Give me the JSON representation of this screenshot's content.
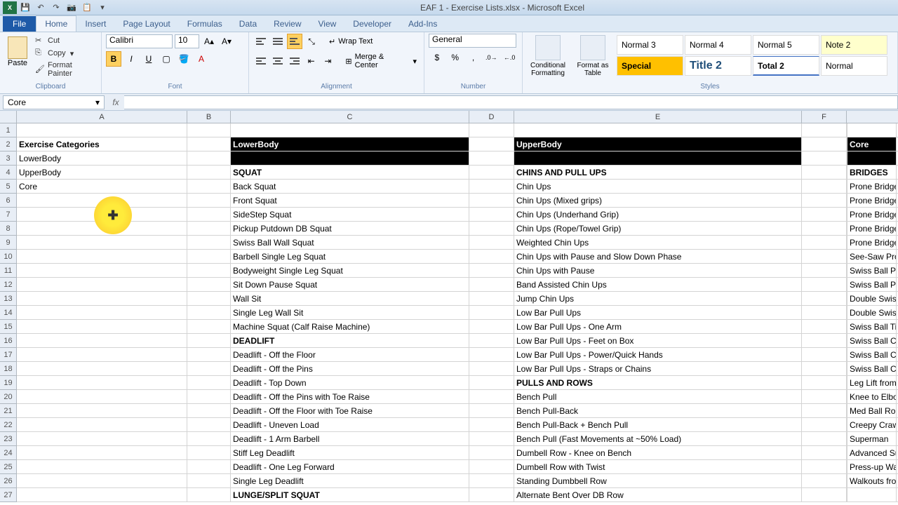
{
  "title": "EAF 1 - Exercise Lists.xlsx - Microsoft Excel",
  "tabs": {
    "file": "File",
    "home": "Home",
    "insert": "Insert",
    "pagelayout": "Page Layout",
    "formulas": "Formulas",
    "data": "Data",
    "review": "Review",
    "view": "View",
    "developer": "Developer",
    "addins": "Add-Ins"
  },
  "ribbon": {
    "clipboard": {
      "paste": "Paste",
      "cut": "Cut",
      "copy": "Copy",
      "format": "Format Painter",
      "label": "Clipboard"
    },
    "font": {
      "name": "Calibri",
      "size": "10",
      "label": "Font"
    },
    "alignment": {
      "wrap": "Wrap Text",
      "merge": "Merge & Center",
      "label": "Alignment"
    },
    "number": {
      "format": "General",
      "label": "Number"
    },
    "styles": {
      "conditional": "Conditional Formatting",
      "astable": "Format as Table",
      "normal3": "Normal 3",
      "normal4": "Normal 4",
      "normal5": "Normal 5",
      "note2": "Note 2",
      "special": "Special",
      "title2": "Title 2",
      "total2": "Total 2",
      "normal": "Normal",
      "label": "Styles"
    }
  },
  "namebox": "Core",
  "columns": [
    "A",
    "B",
    "C",
    "D",
    "E",
    "F"
  ],
  "rownums": [
    1,
    2,
    3,
    4,
    5,
    6,
    7,
    8,
    9,
    10,
    11,
    12,
    13,
    14,
    15,
    16,
    17,
    18,
    19,
    20,
    21,
    22,
    23,
    24,
    25,
    26,
    27
  ],
  "colA": {
    "header": "Exercise Categories",
    "items": [
      "LowerBody",
      "UpperBody",
      "Core"
    ]
  },
  "colC": {
    "header": "LowerBody",
    "items": [
      {
        "t": "SQUAT",
        "b": true
      },
      {
        "t": "Back Squat"
      },
      {
        "t": "Front Squat"
      },
      {
        "t": "SideStep Squat"
      },
      {
        "t": "Pickup Putdown DB Squat"
      },
      {
        "t": "Swiss Ball Wall Squat"
      },
      {
        "t": "Barbell Single Leg Squat"
      },
      {
        "t": "Bodyweight Single Leg Squat"
      },
      {
        "t": "Sit Down Pause Squat"
      },
      {
        "t": "Wall Sit"
      },
      {
        "t": "Single Leg Wall Sit"
      },
      {
        "t": "Machine Squat (Calf Raise Machine)"
      },
      {
        "t": "DEADLIFT",
        "b": true
      },
      {
        "t": "Deadlift - Off the Floor"
      },
      {
        "t": "Deadlift - Off the Pins"
      },
      {
        "t": "Deadlift - Top Down"
      },
      {
        "t": "Deadlift - Off the Pins with Toe Raise"
      },
      {
        "t": "Deadlift - Off the Floor with Toe Raise"
      },
      {
        "t": "Deadlift - Uneven Load"
      },
      {
        "t": "Deadlift - 1 Arm Barbell"
      },
      {
        "t": "Stiff Leg Deadlift"
      },
      {
        "t": "Deadlift - One Leg Forward"
      },
      {
        "t": "Single Leg Deadlift"
      },
      {
        "t": "LUNGE/SPLIT SQUAT",
        "b": true
      }
    ]
  },
  "colE": {
    "header": "UpperBody",
    "items": [
      {
        "t": "CHINS AND PULL UPS",
        "b": true
      },
      {
        "t": "Chin Ups"
      },
      {
        "t": "Chin Ups (Mixed grips)"
      },
      {
        "t": "Chin Ups (Underhand Grip)"
      },
      {
        "t": "Chin Ups (Rope/Towel Grip)"
      },
      {
        "t": "Weighted Chin Ups"
      },
      {
        "t": "Chin Ups with Pause and Slow Down Phase"
      },
      {
        "t": "Chin Ups with Pause"
      },
      {
        "t": "Band Assisted Chin Ups"
      },
      {
        "t": "Jump Chin Ups"
      },
      {
        "t": "Low Bar Pull Ups"
      },
      {
        "t": "Low Bar Pull Ups - One Arm"
      },
      {
        "t": "Low Bar Pull Ups - Feet on Box"
      },
      {
        "t": "Low Bar Pull Ups - Power/Quick Hands"
      },
      {
        "t": "Low Bar Pull Ups - Straps or Chains"
      },
      {
        "t": "PULLS AND ROWS",
        "b": true
      },
      {
        "t": "Bench Pull"
      },
      {
        "t": "Bench Pull-Back"
      },
      {
        "t": "Bench Pull-Back + Bench Pull"
      },
      {
        "t": "Bench Pull (Fast Movements at ~50% Load)"
      },
      {
        "t": "Dumbell Row - Knee on Bench"
      },
      {
        "t": "Dumbell Row with Twist"
      },
      {
        "t": "Standing Dumbbell Row"
      },
      {
        "t": "Alternate Bent Over DB Row"
      }
    ]
  },
  "colG": {
    "header": "Core",
    "items": [
      {
        "t": "BRIDGES",
        "b": true
      },
      {
        "t": "Prone Bridge"
      },
      {
        "t": "Prone Bridge"
      },
      {
        "t": "Prone Bridge"
      },
      {
        "t": "Prone Bridge"
      },
      {
        "t": "Prone Bridge"
      },
      {
        "t": "See-Saw Pror"
      },
      {
        "t": "Swiss Ball Pr"
      },
      {
        "t": "Swiss Ball Pr"
      },
      {
        "t": "Double Swiss"
      },
      {
        "t": "Double Swiss"
      },
      {
        "t": "Swiss Ball Ti"
      },
      {
        "t": "Swiss Ball Cr"
      },
      {
        "t": "Swiss Ball Cr"
      },
      {
        "t": "Swiss Ball Cr"
      },
      {
        "t": "Leg Lift from"
      },
      {
        "t": "Knee to Elbo"
      },
      {
        "t": "Med Ball Rol"
      },
      {
        "t": "Creepy Craw"
      },
      {
        "t": "Superman"
      },
      {
        "t": "Advanced Su"
      },
      {
        "t": "Press-up Wa"
      },
      {
        "t": "Walkouts fro"
      }
    ]
  }
}
